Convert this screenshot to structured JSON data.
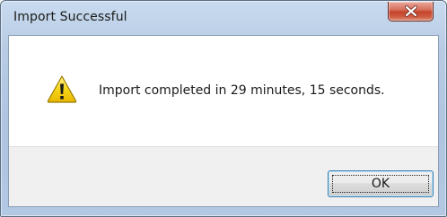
{
  "window": {
    "title": "Import Successful",
    "close_icon": "close-icon"
  },
  "dialog": {
    "icon": "warning-icon",
    "message": "Import completed in 29 minutes, 15 seconds."
  },
  "buttons": {
    "ok_label": "OK"
  },
  "colors": {
    "titlebar": "#b7cbe4",
    "close_button": "#c5432b",
    "warning_yellow": "#f5d20f",
    "button_border": "#3c7fb1",
    "button_area": "#f0f0f0"
  }
}
